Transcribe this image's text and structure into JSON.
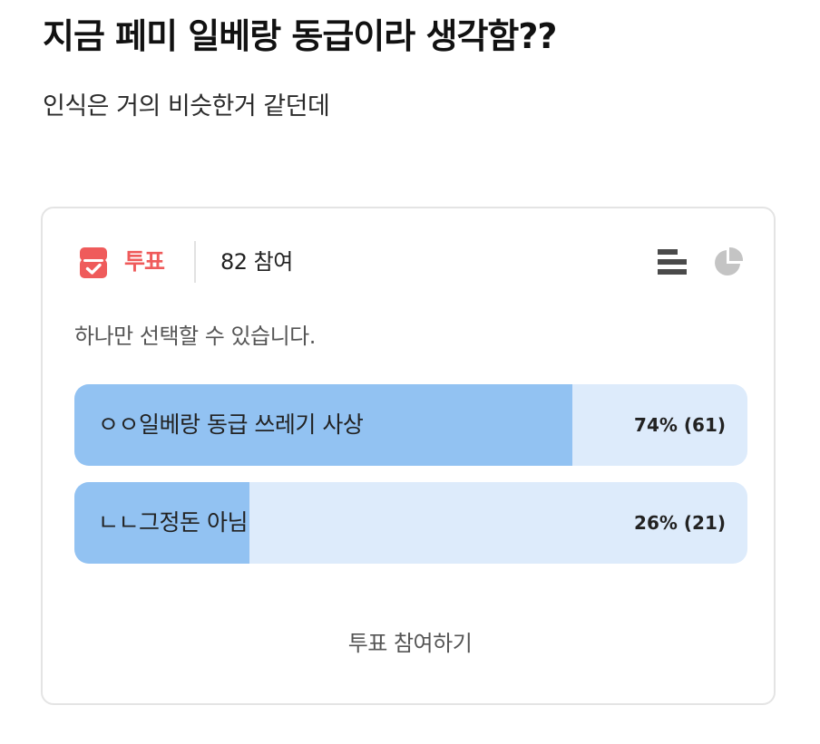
{
  "post": {
    "title": "지금 페미 일베랑 동급이라 생각함??",
    "body": "인식은 거의 비슷한거 같던데"
  },
  "poll": {
    "label": "투표",
    "participants": "82 참여",
    "instruction": "하나만 선택할 수 있습니다.",
    "options": [
      {
        "label": "ㅇㅇ일베랑 동급 쓰레기 사상",
        "result": "74% (61)",
        "percent": 74,
        "votes": 61
      },
      {
        "label": "ㄴㄴ그정돈 아님",
        "result": "26% (21)",
        "percent": 26,
        "votes": 21
      }
    ],
    "vote_button": "투표 참여하기",
    "colors": {
      "accent": "#ef5b5b",
      "bar_fill": "#92c2f2",
      "bar_track": "#ddebfb",
      "icon_gray": "#4a4a4a",
      "pie_gray": "#c4c4c4"
    },
    "icons": {
      "vote": "ballot-box-icon",
      "bar_view": "bar-chart-icon",
      "pie_view": "pie-chart-icon"
    }
  }
}
